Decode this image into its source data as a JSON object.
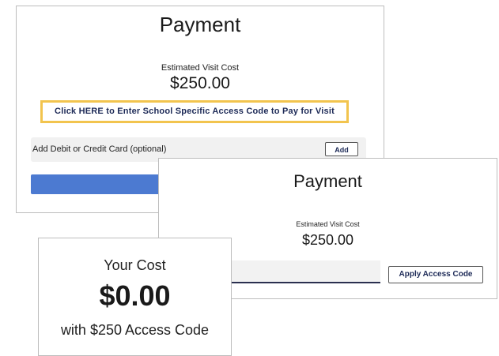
{
  "panel1": {
    "title": "Payment",
    "estimated_label": "Estimated Visit Cost",
    "estimated_value": "$250.00",
    "access_code_link": "Click HERE to Enter School Specific Access Code to Pay for Visit",
    "card_label": "Add Debit or Credit Card (optional)",
    "add_button": "Add",
    "accent_highlight": "#f2c44e",
    "pay_bar_color": "#4c7ad1"
  },
  "panel2": {
    "title": "Payment",
    "estimated_label": "Estimated Visit Cost",
    "estimated_value": "$250.00",
    "access_code_input_value": "",
    "apply_button": "Apply Access Code"
  },
  "panel3": {
    "your_cost_label": "Your Cost",
    "your_cost_value": "$0.00",
    "with_code_text": "with $250 Access Code"
  }
}
